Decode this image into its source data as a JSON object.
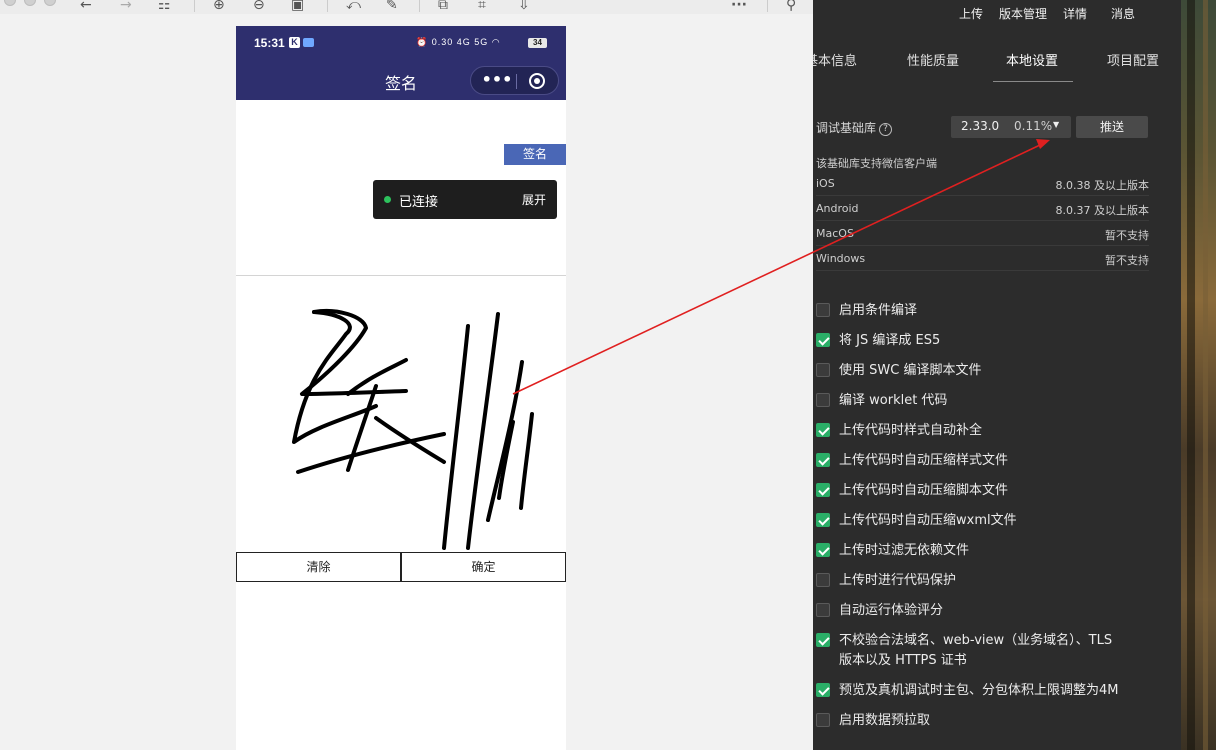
{
  "toolbar": {
    "icons": [
      "back-icon",
      "forward-icon",
      "grid-icon",
      "zoom-in-icon",
      "zoom-out-icon",
      "fit-icon",
      "rotate-icon",
      "edit-icon",
      "translate-icon",
      "scan-icon",
      "save-icon",
      "more-icon",
      "pin-icon"
    ]
  },
  "phone": {
    "status": {
      "time": "15:31",
      "k_badge": "K",
      "network": "0.30 4G 5G",
      "battery": "34"
    },
    "nav_title": "签名",
    "sign_label": "签名",
    "toast": {
      "text": "已连接",
      "expand": "展开"
    },
    "buttons": {
      "clear": "清除",
      "confirm": "确定"
    }
  },
  "panel": {
    "top_actions": [
      "上传",
      "版本管理",
      "详情",
      "消息"
    ],
    "tabs": [
      "基本信息",
      "性能质量",
      "本地设置",
      "项目配置"
    ],
    "active_tab": "本地设置",
    "debug_lib": {
      "label": "调试基础库",
      "help": "?",
      "version": "2.33.0",
      "percent": "0.11%",
      "push": "推送"
    },
    "support_title": "该基础库支持微信客户端",
    "support": [
      {
        "os": "iOS",
        "req": "8.0.38 及以上版本"
      },
      {
        "os": "Android",
        "req": "8.0.37 及以上版本"
      },
      {
        "os": "MacOS",
        "req": "暂不支持"
      },
      {
        "os": "Windows",
        "req": "暂不支持"
      }
    ],
    "options": [
      {
        "label": "启用条件编译",
        "checked": false
      },
      {
        "label": "将 JS 编译成 ES5",
        "checked": true
      },
      {
        "label": "使用 SWC 编译脚本文件",
        "checked": false
      },
      {
        "label": "编译 worklet 代码",
        "checked": false
      },
      {
        "label": "上传代码时样式自动补全",
        "checked": true
      },
      {
        "label": "上传代码时自动压缩样式文件",
        "checked": true
      },
      {
        "label": "上传代码时自动压缩脚本文件",
        "checked": true
      },
      {
        "label": "上传代码时自动压缩wxml文件",
        "checked": true
      },
      {
        "label": "上传时过滤无依赖文件",
        "checked": true
      },
      {
        "label": "上传时进行代码保护",
        "checked": false
      },
      {
        "label": "自动运行体验评分",
        "checked": false
      },
      {
        "label": "不校验合法域名、web-view（业务域名）、TLS",
        "label2": "版本以及 HTTPS 证书",
        "checked": true
      },
      {
        "label": "预览及真机调试时主包、分包体积上限调整为4M",
        "checked": true
      },
      {
        "label": "启用数据预拉取",
        "checked": false
      }
    ]
  },
  "colors": {
    "nav_bg": "#2e2f6e",
    "sign_label_bg": "#4a67b6",
    "panel_bg": "#2c2c2c",
    "check_green": "#2aae67",
    "arrow_red": "#e02020"
  }
}
